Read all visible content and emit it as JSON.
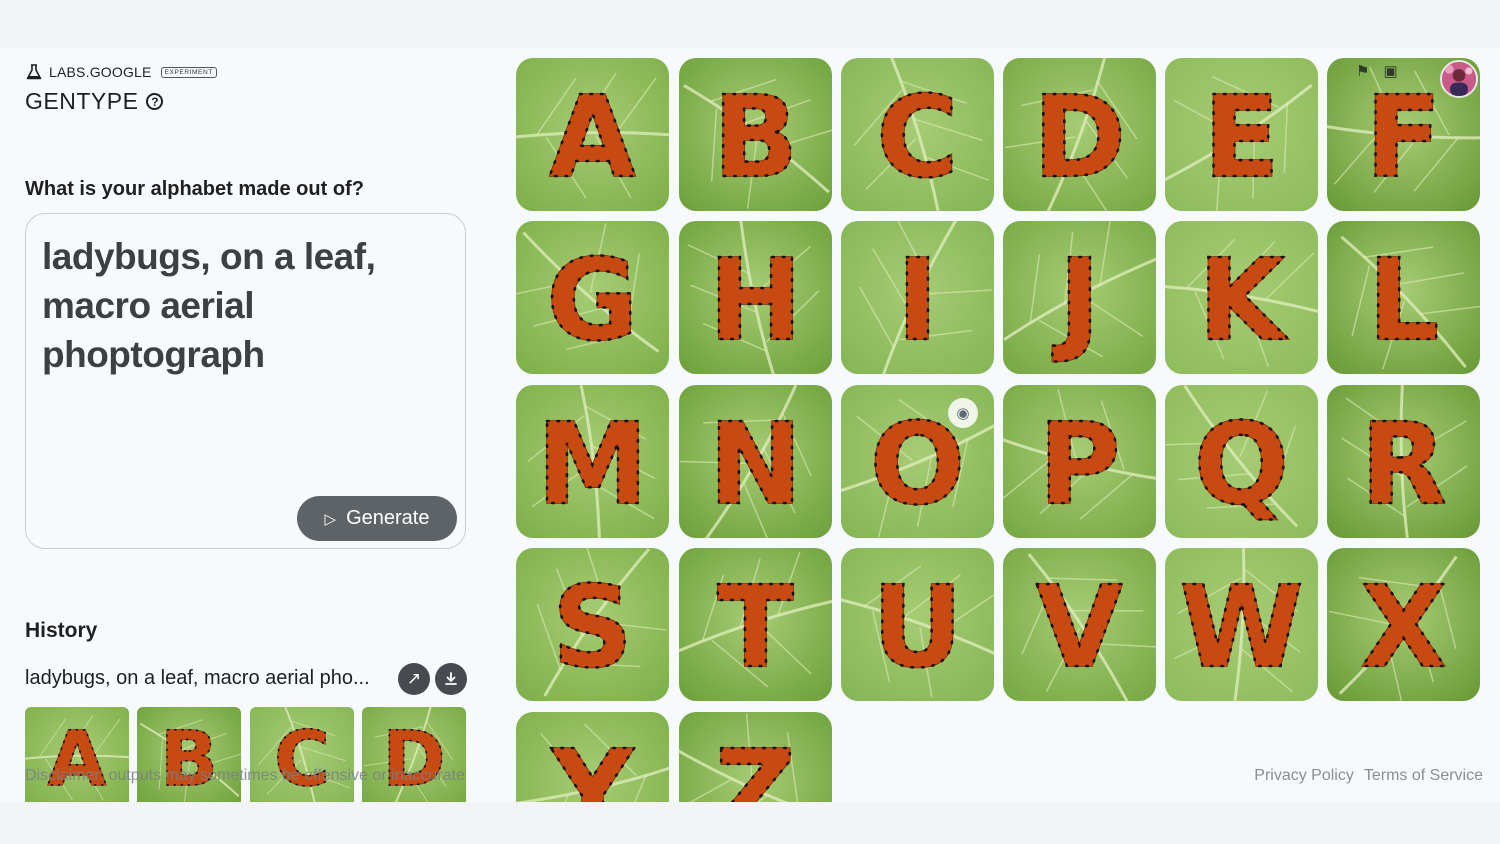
{
  "brand": {
    "name": "LABS.GOOGLE",
    "badge": "EXPERIMENT",
    "icon": "flask-icon"
  },
  "app": {
    "title": "GENTYPE",
    "help_icon": "help-icon"
  },
  "prompt": {
    "question": "What is your alphabet made out of?",
    "value": "ladybugs, on a leaf, macro aerial phoptograph",
    "generate_label": "Generate",
    "generate_icon": "send-sparkle-icon"
  },
  "history": {
    "title": "History",
    "items": [
      {
        "label": "ladybugs, on a leaf, macro aerial pho...",
        "thumbnails": [
          "A",
          "B",
          "C",
          "D"
        ]
      }
    ],
    "open_icon": "open-arrow-icon",
    "download_icon": "download-icon"
  },
  "disclaimer": "Disclaimer: outputs may sometimes be offensive or inaccurate",
  "footer": {
    "privacy": "Privacy Policy",
    "terms": "Terms of Service"
  },
  "grid": {
    "letters": [
      "A",
      "B",
      "C",
      "D",
      "E",
      "F",
      "G",
      "H",
      "I",
      "J",
      "K",
      "L",
      "M",
      "N",
      "O",
      "P",
      "Q",
      "R",
      "S",
      "T",
      "U",
      "V",
      "W",
      "X",
      "Y",
      "Z"
    ],
    "lens_icon": "google-lens-icon"
  },
  "top_bar": {
    "icons": [
      "feedback-flag-icon",
      "gallery-icon"
    ],
    "avatar": "user-avatar"
  },
  "colors": {
    "leaf": "#7fae4a",
    "leaf_dark": "#5e8f33",
    "ladybug": "#c84a13",
    "button": "#5e6368",
    "accent_text": "#1f1f1f"
  }
}
